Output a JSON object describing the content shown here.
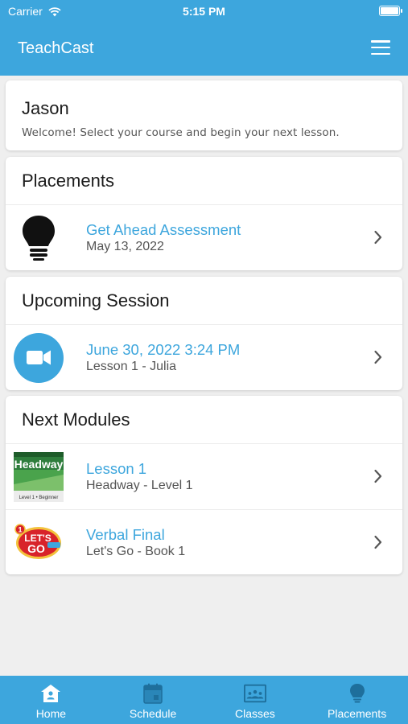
{
  "status_bar": {
    "carrier": "Carrier",
    "time": "5:15 PM"
  },
  "app": {
    "title": "TeachCast",
    "menu_icon": "hamburger-menu-icon"
  },
  "colors": {
    "brand": "#3da6dd",
    "background": "#efefef"
  },
  "user": {
    "name": "Jason",
    "welcome": "Welcome! Select your course and begin your next lesson."
  },
  "placements": {
    "header": "Placements",
    "items": [
      {
        "title": "Get Ahead Assessment",
        "subtitle": "May 13, 2022",
        "icon": "lightbulb-icon"
      }
    ]
  },
  "upcoming_session": {
    "header": "Upcoming Session",
    "items": [
      {
        "title": "June 30, 2022 3:24 PM",
        "subtitle": "Lesson 1 - Julia",
        "icon": "video-camera-icon"
      }
    ]
  },
  "next_modules": {
    "header": "Next Modules",
    "items": [
      {
        "title": "Lesson 1",
        "subtitle": "Headway - Level 1",
        "icon": "headway-book-cover",
        "cover_text": {
          "brand": "Headway",
          "level": "Level 1 • Beginner"
        }
      },
      {
        "title": "Verbal Final",
        "subtitle": "Let's Go - Book 1",
        "icon": "lets-go-logo",
        "cover_text": {
          "line1": "LET'S",
          "line2": "GO",
          "num": "1"
        }
      }
    ]
  },
  "tabs": [
    {
      "label": "Home",
      "icon": "home-icon"
    },
    {
      "label": "Schedule",
      "icon": "calendar-icon"
    },
    {
      "label": "Classes",
      "icon": "classroom-icon"
    },
    {
      "label": "Placements",
      "icon": "lightbulb-icon"
    }
  ]
}
